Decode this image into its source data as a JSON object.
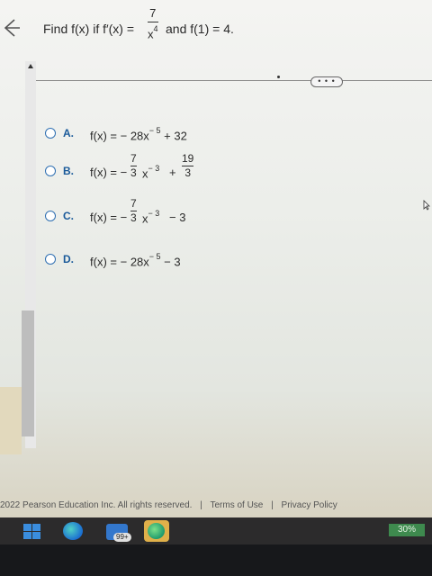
{
  "question": {
    "prefix": "Find f(x) if  f′(x) =",
    "frac_num": "7",
    "frac_den": "x",
    "frac_den_exp": "4",
    "suffix": "and f(1) = 4."
  },
  "more_button": {
    "label": "• • •"
  },
  "options": [
    {
      "letter": "A.",
      "lhs": "f(x) =",
      "body": "− 28x",
      "exp": "− 5",
      "tail": "+ 32"
    },
    {
      "letter": "B.",
      "lhs": "f(x) = −",
      "coef_num": "7",
      "coef_den": "3",
      "body": "x",
      "exp": "− 3",
      "plus": "+",
      "const_num": "19",
      "const_den": "3"
    },
    {
      "letter": "C.",
      "lhs": "f(x) = −",
      "coef_num": "7",
      "coef_den": "3",
      "body": "x",
      "exp": "− 3",
      "tail": "− 3"
    },
    {
      "letter": "D.",
      "lhs": "f(x) =",
      "body": "− 28x",
      "exp": "− 5",
      "tail": "− 3"
    }
  ],
  "footer": {
    "copyright": "2022 Pearson Education Inc. All rights reserved.",
    "sep1": "|",
    "terms": "Terms of Use",
    "sep2": "|",
    "privacy": "Privacy Policy"
  },
  "taskbar": {
    "store_badge": "99+",
    "battery": "30%"
  },
  "colors": {
    "radio_border": "#2f6fb2",
    "option_letter": "#1a5a9a",
    "battery_bg": "#3e8a4e"
  }
}
